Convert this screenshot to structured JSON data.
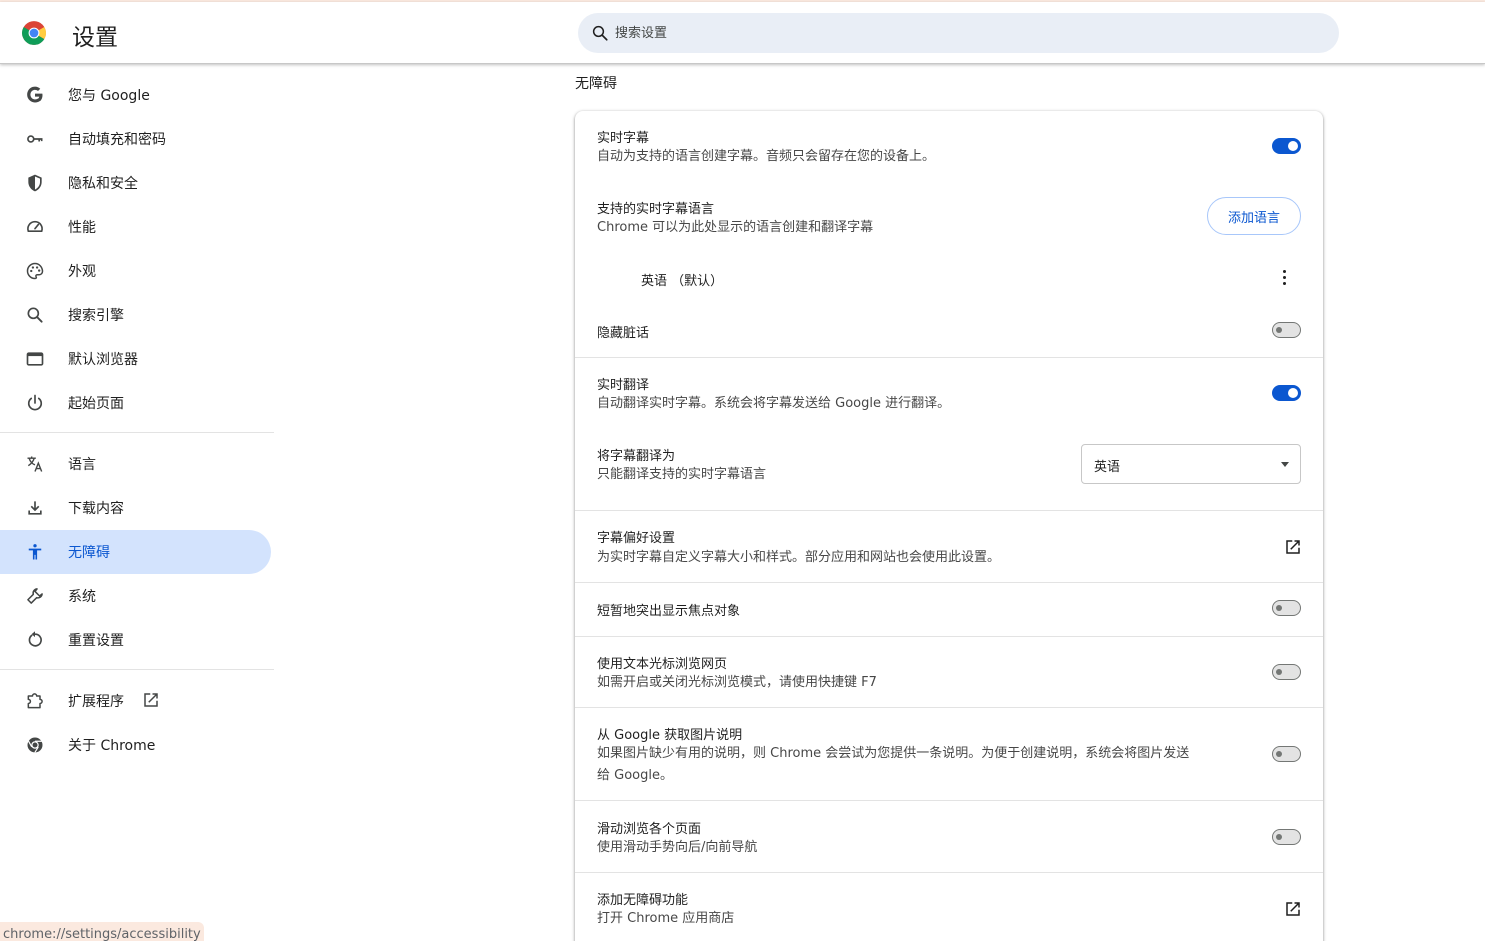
{
  "header": {
    "title": "设置",
    "search_placeholder": "搜索设置"
  },
  "sidebar": {
    "items": [
      {
        "label": "您与 Google",
        "icon": "google-g-icon"
      },
      {
        "label": "自动填充和密码",
        "icon": "key-icon"
      },
      {
        "label": "隐私和安全",
        "icon": "shield-icon"
      },
      {
        "label": "性能",
        "icon": "speedometer-icon"
      },
      {
        "label": "外观",
        "icon": "palette-icon"
      },
      {
        "label": "搜索引擎",
        "icon": "search-icon"
      },
      {
        "label": "默认浏览器",
        "icon": "browser-window-icon"
      },
      {
        "label": "起始页面",
        "icon": "power-icon"
      },
      {
        "label": "语言",
        "icon": "translate-icon"
      },
      {
        "label": "下载内容",
        "icon": "download-icon"
      },
      {
        "label": "无障碍",
        "icon": "accessibility-icon",
        "active": true
      },
      {
        "label": "系统",
        "icon": "wrench-icon"
      },
      {
        "label": "重置设置",
        "icon": "reset-icon"
      },
      {
        "label": "扩展程序",
        "icon": "puzzle-icon"
      },
      {
        "label": "关于 Chrome",
        "icon": "chrome-icon"
      }
    ]
  },
  "main": {
    "section_title": "无障碍",
    "live_caption": {
      "title": "实时字幕",
      "desc": "自动为支持的语言创建字幕。音频只会留存在您的设备上。",
      "enabled": true
    },
    "caption_languages": {
      "title": "支持的实时字幕语言",
      "desc": "Chrome 可以为此处显示的语言创建和翻译字幕",
      "add_button": "添加语言",
      "language_item": "英语 （默认）"
    },
    "mask_profanity": {
      "title": "隐藏脏话",
      "enabled": false
    },
    "live_translate": {
      "title": "实时翻译",
      "desc": "自动翻译实时字幕。系统会将字幕发送给 Google 进行翻译。",
      "enabled": true
    },
    "translate_to": {
      "title": "将字幕翻译为",
      "desc": "只能翻译支持的实时字幕语言",
      "selected": "英语"
    },
    "caption_prefs": {
      "title": "字幕偏好设置",
      "desc": "为实时字幕自定义字幕大小和样式。部分应用和网站也会使用此设置。"
    },
    "focus_highlight": {
      "title": "短暂地突出显示焦点对象",
      "enabled": false
    },
    "caret_browsing": {
      "title": "使用文本光标浏览网页",
      "desc": "如需开启或关闭光标浏览模式，请使用快捷键 F7",
      "enabled": false
    },
    "image_descriptions": {
      "title": "从 Google 获取图片说明",
      "desc_line1": "如果图片缺少有用的说明，则 Chrome 会尝试为您提供一条说明。为便于创建说明，系统会将图片发送",
      "desc_line2": "给 Google。",
      "enabled": false
    },
    "swipe_navigation": {
      "title": "滑动浏览各个页面",
      "desc": "使用滑动手势向后/向前导航",
      "enabled": false
    },
    "add_accessibility": {
      "title": "添加无障碍功能",
      "desc": "打开 Chrome 应用商店"
    }
  },
  "status_bar": {
    "url": "chrome://settings/accessibility"
  },
  "colors": {
    "accent": "#0b57d0",
    "active_nav_bg": "#d3e3fd",
    "search_bg": "#e9eef6"
  }
}
